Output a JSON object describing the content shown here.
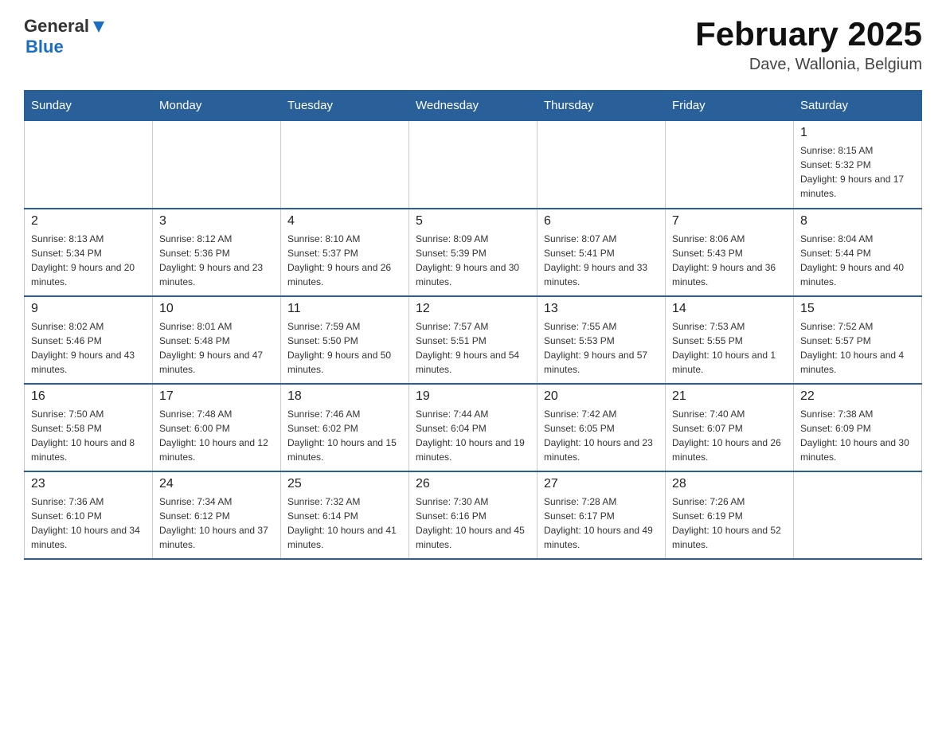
{
  "header": {
    "logo_general": "General",
    "logo_blue": "Blue",
    "month_title": "February 2025",
    "location": "Dave, Wallonia, Belgium"
  },
  "weekdays": [
    "Sunday",
    "Monday",
    "Tuesday",
    "Wednesday",
    "Thursday",
    "Friday",
    "Saturday"
  ],
  "weeks": [
    [
      {
        "day": "",
        "info": ""
      },
      {
        "day": "",
        "info": ""
      },
      {
        "day": "",
        "info": ""
      },
      {
        "day": "",
        "info": ""
      },
      {
        "day": "",
        "info": ""
      },
      {
        "day": "",
        "info": ""
      },
      {
        "day": "1",
        "info": "Sunrise: 8:15 AM\nSunset: 5:32 PM\nDaylight: 9 hours and 17 minutes."
      }
    ],
    [
      {
        "day": "2",
        "info": "Sunrise: 8:13 AM\nSunset: 5:34 PM\nDaylight: 9 hours and 20 minutes."
      },
      {
        "day": "3",
        "info": "Sunrise: 8:12 AM\nSunset: 5:36 PM\nDaylight: 9 hours and 23 minutes."
      },
      {
        "day": "4",
        "info": "Sunrise: 8:10 AM\nSunset: 5:37 PM\nDaylight: 9 hours and 26 minutes."
      },
      {
        "day": "5",
        "info": "Sunrise: 8:09 AM\nSunset: 5:39 PM\nDaylight: 9 hours and 30 minutes."
      },
      {
        "day": "6",
        "info": "Sunrise: 8:07 AM\nSunset: 5:41 PM\nDaylight: 9 hours and 33 minutes."
      },
      {
        "day": "7",
        "info": "Sunrise: 8:06 AM\nSunset: 5:43 PM\nDaylight: 9 hours and 36 minutes."
      },
      {
        "day": "8",
        "info": "Sunrise: 8:04 AM\nSunset: 5:44 PM\nDaylight: 9 hours and 40 minutes."
      }
    ],
    [
      {
        "day": "9",
        "info": "Sunrise: 8:02 AM\nSunset: 5:46 PM\nDaylight: 9 hours and 43 minutes."
      },
      {
        "day": "10",
        "info": "Sunrise: 8:01 AM\nSunset: 5:48 PM\nDaylight: 9 hours and 47 minutes."
      },
      {
        "day": "11",
        "info": "Sunrise: 7:59 AM\nSunset: 5:50 PM\nDaylight: 9 hours and 50 minutes."
      },
      {
        "day": "12",
        "info": "Sunrise: 7:57 AM\nSunset: 5:51 PM\nDaylight: 9 hours and 54 minutes."
      },
      {
        "day": "13",
        "info": "Sunrise: 7:55 AM\nSunset: 5:53 PM\nDaylight: 9 hours and 57 minutes."
      },
      {
        "day": "14",
        "info": "Sunrise: 7:53 AM\nSunset: 5:55 PM\nDaylight: 10 hours and 1 minute."
      },
      {
        "day": "15",
        "info": "Sunrise: 7:52 AM\nSunset: 5:57 PM\nDaylight: 10 hours and 4 minutes."
      }
    ],
    [
      {
        "day": "16",
        "info": "Sunrise: 7:50 AM\nSunset: 5:58 PM\nDaylight: 10 hours and 8 minutes."
      },
      {
        "day": "17",
        "info": "Sunrise: 7:48 AM\nSunset: 6:00 PM\nDaylight: 10 hours and 12 minutes."
      },
      {
        "day": "18",
        "info": "Sunrise: 7:46 AM\nSunset: 6:02 PM\nDaylight: 10 hours and 15 minutes."
      },
      {
        "day": "19",
        "info": "Sunrise: 7:44 AM\nSunset: 6:04 PM\nDaylight: 10 hours and 19 minutes."
      },
      {
        "day": "20",
        "info": "Sunrise: 7:42 AM\nSunset: 6:05 PM\nDaylight: 10 hours and 23 minutes."
      },
      {
        "day": "21",
        "info": "Sunrise: 7:40 AM\nSunset: 6:07 PM\nDaylight: 10 hours and 26 minutes."
      },
      {
        "day": "22",
        "info": "Sunrise: 7:38 AM\nSunset: 6:09 PM\nDaylight: 10 hours and 30 minutes."
      }
    ],
    [
      {
        "day": "23",
        "info": "Sunrise: 7:36 AM\nSunset: 6:10 PM\nDaylight: 10 hours and 34 minutes."
      },
      {
        "day": "24",
        "info": "Sunrise: 7:34 AM\nSunset: 6:12 PM\nDaylight: 10 hours and 37 minutes."
      },
      {
        "day": "25",
        "info": "Sunrise: 7:32 AM\nSunset: 6:14 PM\nDaylight: 10 hours and 41 minutes."
      },
      {
        "day": "26",
        "info": "Sunrise: 7:30 AM\nSunset: 6:16 PM\nDaylight: 10 hours and 45 minutes."
      },
      {
        "day": "27",
        "info": "Sunrise: 7:28 AM\nSunset: 6:17 PM\nDaylight: 10 hours and 49 minutes."
      },
      {
        "day": "28",
        "info": "Sunrise: 7:26 AM\nSunset: 6:19 PM\nDaylight: 10 hours and 52 minutes."
      },
      {
        "day": "",
        "info": ""
      }
    ]
  ]
}
